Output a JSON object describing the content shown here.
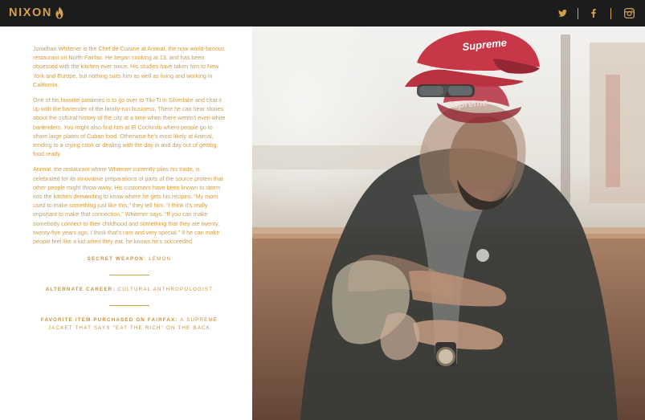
{
  "header": {
    "brand": "NIXON",
    "brand_color": "#d4a24c",
    "social_icons": [
      "twitter-icon",
      "facebook-icon",
      "instagram-icon"
    ]
  },
  "bio": {
    "paragraphs": [
      "Jonathan Whitener is the Chef de Cuisine at Animal, the now world-famous restaurant on North Fairfax. He began cooking at 13, and has been obsessed with the kitchen ever since. His studies have taken him to New York and Europe, but nothing suits him as well as living and working in California.",
      "One of his favorite pastimes is to go over to Tiki-Ti in Silverlake and chat it up with the bartender of the family-run business. There he can hear stories about the cultural history of the city at a time when there weren't even white bartenders. You might also find him at El Cochinito where people go to share large plates of Cuban food. Otherwise he's most likely at Animal, tending to a crying cook or dealing with the day in and day out of getting food ready.",
      "Animal, the restaurant where Whitener currently plies his trade, is celebrated for its innovative preparations of parts of the source protein that other people might throw away. His customers have been known to storm into the kitchen demanding to know where he gets his recipes. “My mom used to make something just like this,” they tell him. “I think it's really important to make that connection,” Whitener says. “If you can make somebody connect to their childhood and something that they ate twenty, twenty-five years ago, I think that's rare and very special.” If he can make people feel like a kid when they eat, he knows he's succeeded."
    ]
  },
  "facts": [
    {
      "label": "Secret Weapon:",
      "value": "Lemon"
    },
    {
      "label": "Alternate Career:",
      "value": "Cultural Anthropologist"
    },
    {
      "label": "Favorite Item Purchased on Fairfax:",
      "value": "A Supreme Jacket that says \"Eat the Rich\" on the back"
    }
  ],
  "photo": {
    "cap_text_1": "Supreme",
    "cap_text_2": "Supreme"
  }
}
